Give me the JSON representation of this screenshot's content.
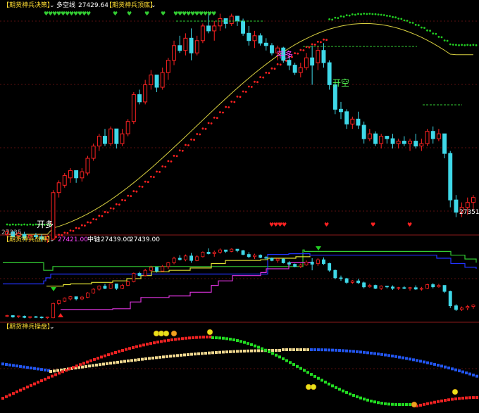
{
  "panels": {
    "main": {
      "indicator_name": "【期货神兵决策】",
      "line_name": "多空线",
      "line_value": "27429.64",
      "top_name": "【期货神兵顶底】",
      "last_price_label": "27351",
      "left_price_label": "27335",
      "signals": {
        "open_long": "开多",
        "flat_long": "平多",
        "open_short": "开空"
      }
    },
    "mid": {
      "indicator_name": "【期货神兵战神】",
      "v1": "27421.00",
      "mid_name": "中轴",
      "v2": "27439.00",
      "v3": "27439.00"
    },
    "bottom": {
      "indicator_name": "【期货神兵操盘】"
    }
  },
  "colors": {
    "background": "#000000",
    "up_candle": "#ff2222",
    "down_candle": "#3fd8e8",
    "dots_red": "#ff2020",
    "dots_green": "#22cc22",
    "ma_yellow": "#d8d040",
    "title_yellow": "#ffdd33",
    "label_magenta": "#ff44ff",
    "label_green": "#55ff55",
    "panel_separator": "#8b1a1a"
  },
  "chart_data": {
    "type": "candlestick",
    "candles": [
      [
        27290,
        27310,
        27280,
        27300
      ],
      [
        27300,
        27305,
        27270,
        27280
      ],
      [
        27285,
        27300,
        27270,
        27295
      ],
      [
        27290,
        27300,
        27265,
        27275
      ],
      [
        27275,
        27290,
        27260,
        27285
      ],
      [
        27285,
        27295,
        27270,
        27280
      ],
      [
        27280,
        27290,
        27260,
        27270
      ],
      [
        27270,
        27285,
        27255,
        27280
      ],
      [
        27270,
        27470,
        27265,
        27460
      ],
      [
        27460,
        27510,
        27440,
        27500
      ],
      [
        27490,
        27540,
        27480,
        27530
      ],
      [
        27520,
        27560,
        27500,
        27550
      ],
      [
        27550,
        27540,
        27500,
        27520
      ],
      [
        27520,
        27560,
        27505,
        27545
      ],
      [
        27540,
        27610,
        27530,
        27600
      ],
      [
        27600,
        27660,
        27590,
        27650
      ],
      [
        27650,
        27700,
        27630,
        27690
      ],
      [
        27690,
        27720,
        27650,
        27660
      ],
      [
        27660,
        27730,
        27650,
        27720
      ],
      [
        27720,
        27700,
        27640,
        27660
      ],
      [
        27660,
        27720,
        27650,
        27700
      ],
      [
        27700,
        27760,
        27690,
        27750
      ],
      [
        27750,
        27870,
        27740,
        27860
      ],
      [
        27860,
        27880,
        27820,
        27830
      ],
      [
        27830,
        27920,
        27820,
        27900
      ],
      [
        27900,
        27960,
        27880,
        27940
      ],
      [
        27940,
        27920,
        27870,
        27890
      ],
      [
        27890,
        27970,
        27880,
        27950
      ],
      [
        27950,
        28010,
        27920,
        28000
      ],
      [
        28000,
        28080,
        27980,
        28060
      ],
      [
        28060,
        28100,
        28030,
        28040
      ],
      [
        28040,
        28110,
        28020,
        28090
      ],
      [
        28090,
        28130,
        28000,
        28030
      ],
      [
        28030,
        28100,
        28020,
        28080
      ],
      [
        28080,
        28150,
        28070,
        28140
      ],
      [
        28140,
        28190,
        28110,
        28120
      ],
      [
        28120,
        28160,
        28080,
        28140
      ],
      [
        28140,
        28190,
        28120,
        28170
      ],
      [
        28170,
        28165,
        28130,
        28150
      ],
      [
        28150,
        28190,
        28140,
        28180
      ],
      [
        28180,
        28175,
        28140,
        28160
      ],
      [
        28160,
        28170,
        28100,
        28110
      ],
      [
        28110,
        28140,
        28060,
        28080
      ],
      [
        28080,
        28120,
        28050,
        28100
      ],
      [
        28100,
        28110,
        28060,
        28070
      ],
      [
        28070,
        28090,
        28040,
        28060
      ],
      [
        28060,
        28070,
        28020,
        28030
      ],
      [
        28030,
        28060,
        28000,
        28050
      ],
      [
        28050,
        28055,
        27990,
        28000
      ],
      [
        28000,
        28020,
        27960,
        27980
      ],
      [
        27980,
        27990,
        27940,
        27950
      ],
      [
        27950,
        27990,
        27930,
        27970
      ],
      [
        27970,
        28030,
        27960,
        28010
      ],
      [
        28010,
        28060,
        27900,
        27980
      ],
      [
        27990,
        28060,
        27960,
        28040
      ],
      [
        28040,
        28070,
        27970,
        27990
      ],
      [
        27990,
        28000,
        27880,
        27900
      ],
      [
        27900,
        27910,
        27780,
        27800
      ],
      [
        27800,
        27830,
        27760,
        27790
      ],
      [
        27790,
        27800,
        27720,
        27740
      ],
      [
        27740,
        27770,
        27720,
        27760
      ],
      [
        27760,
        27790,
        27720,
        27735
      ],
      [
        27735,
        27750,
        27660,
        27680
      ],
      [
        27680,
        27720,
        27670,
        27700
      ],
      [
        27700,
        27710,
        27650,
        27660
      ],
      [
        27660,
        27700,
        27640,
        27690
      ],
      [
        27690,
        27690,
        27660,
        27680
      ],
      [
        27680,
        27700,
        27640,
        27660
      ],
      [
        27660,
        27680,
        27640,
        27670
      ],
      [
        27670,
        27690,
        27650,
        27660
      ],
      [
        27660,
        27680,
        27630,
        27670
      ],
      [
        27670,
        27700,
        27640,
        27650
      ],
      [
        27650,
        27680,
        27630,
        27660
      ],
      [
        27660,
        27720,
        27650,
        27710
      ],
      [
        27710,
        27730,
        27660,
        27680
      ],
      [
        27680,
        27720,
        27670,
        27700
      ],
      [
        27700,
        27700,
        27600,
        27620
      ],
      [
        27620,
        27630,
        27400,
        27430
      ],
      [
        27430,
        27450,
        27360,
        27380
      ],
      [
        27380,
        27420,
        27360,
        27400
      ],
      [
        27400,
        27440,
        27370,
        27420
      ],
      [
        27420,
        27450,
        27390,
        27440
      ]
    ],
    "yrange": [
      27310,
      28200
    ],
    "notes": "Candles given as [open, high, low, close]; sequence is the approximate price path of the main panel."
  }
}
